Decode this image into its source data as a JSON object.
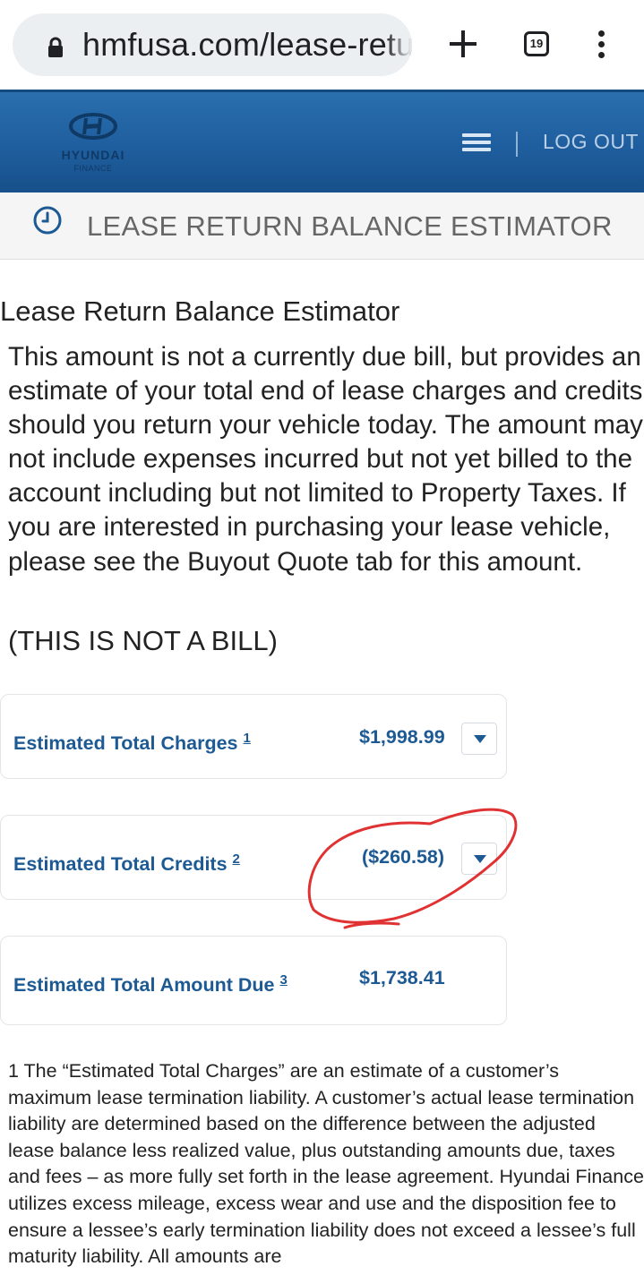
{
  "browser": {
    "url": "hmfusa.com/lease-retu",
    "tab_count": "19",
    "icons": [
      "lock-icon",
      "plus-icon",
      "tabs-icon",
      "overflow-menu-icon"
    ]
  },
  "header": {
    "brand": "HYUNDAI",
    "brand_sub": "FINANCE",
    "logout_label": "LOG OUT",
    "background_color": "#1f5e9e"
  },
  "titlebar": {
    "title": "LEASE RETURN BALANCE ESTIMATOR"
  },
  "main": {
    "heading": "Lease Return Balance Estimator",
    "intro": "This amount is not a currently due bill, but provides an estimate of your total end of lease charges and credits should you return your vehicle today. The amount may not include expenses incurred but not yet billed to the account including but not limited to Property Taxes. If you are interested in purchasing your lease vehicle, please see the Buyout Quote tab for this amount.",
    "not_a_bill": "(THIS IS NOT A BILL)",
    "rows": [
      {
        "label": "Estimated Total Charges",
        "note": "1",
        "value": "$1,998.99"
      },
      {
        "label": "Estimated Total Credits",
        "note": "2",
        "value": "($260.58)"
      },
      {
        "label": "Estimated Total Amount Due",
        "note": "3",
        "value": "$1,738.41"
      }
    ],
    "footnote": "1 The “Estimated Total Charges” are an estimate of a customer’s maximum lease termination liability. A customer’s actual lease termination liability are determined based on the difference between the adjusted lease balance less realized value, plus outstanding amounts due, taxes and fees – as more fully set forth in the lease agreement. Hyundai Finance utilizes excess mileage, excess wear and use and the disposition fee to ensure a lessee’s early termination liability does not exceed a lessee’s full maturity liability. All amounts are"
  },
  "colors": {
    "label_blue": "#1d5a94",
    "annotation_red": "#e03232"
  }
}
